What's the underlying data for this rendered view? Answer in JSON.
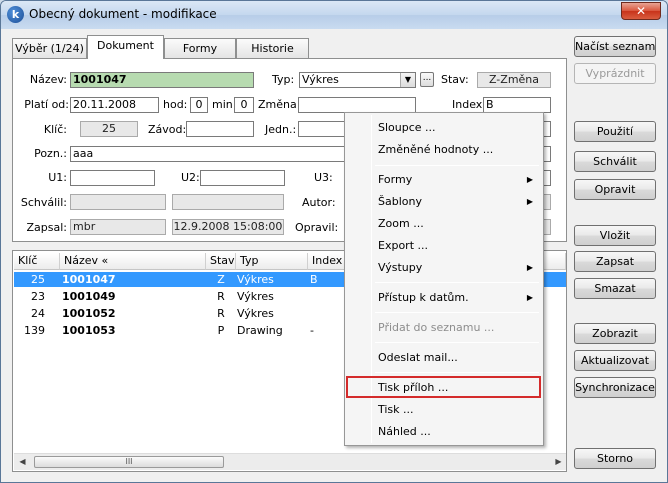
{
  "window": {
    "title": "Obecný dokument - modifikace",
    "close_label": "✕"
  },
  "tabs": [
    {
      "label": "Výběr (1/24)"
    },
    {
      "label": "Dokument"
    },
    {
      "label": "Formy"
    },
    {
      "label": "Historie"
    }
  ],
  "form": {
    "nazev_label": "Název:",
    "nazev_value": "1001047",
    "typ_label": "Typ:",
    "typ_value": "Výkres",
    "typ_more": "...",
    "stav_label": "Stav:",
    "stav_value": "Z-Změna",
    "platiod_label": "Platí od:",
    "platiod_value": "20.11.2008",
    "hod_label": "hod:",
    "hod_value": "0",
    "min_label": "min:",
    "min_value": "0",
    "zmena_label": "Změna:",
    "zmena_value": "",
    "index_label": "Index:",
    "index_value": "B",
    "klic_label": "Klíč:",
    "klic_value": "25",
    "zavod_label": "Závod:",
    "zavod_value": "",
    "jedn_label": "Jedn.:",
    "pozn_label": "Pozn.:",
    "pozn_value": "aaa",
    "u1_label": "U1:",
    "u2_label": "U2:",
    "u3_label": "U3:",
    "schvalil_label": "Schválil:",
    "autor_label": "Autor:",
    "zapsal_label": "Zapsal:",
    "zapsal_value": "mbr",
    "zapsal_date": "12.9.2008 15:08:00",
    "opravil_label": "Opravil:"
  },
  "grid": {
    "columns": [
      "Klíč",
      "Název «",
      "Stav",
      "Typ",
      "Index"
    ],
    "rows": [
      {
        "klic": "25",
        "nazev": "1001047",
        "stav": "Z",
        "typ": "Výkres",
        "index": "B"
      },
      {
        "klic": "23",
        "nazev": "1001049",
        "stav": "R",
        "typ": "Výkres",
        "index": ""
      },
      {
        "klic": "24",
        "nazev": "1001052",
        "stav": "R",
        "typ": "Výkres",
        "index": ""
      },
      {
        "klic": "139",
        "nazev": "1001053",
        "stav": "P",
        "typ": "Drawing",
        "index": "-"
      }
    ],
    "scroll_thumb": "III"
  },
  "buttons": {
    "nacist": "Načíst seznam",
    "vyprazdnit": "Vyprázdnit",
    "pouziti": "Použití",
    "schvalit": "Schválit",
    "opravit": "Opravit",
    "vlozit": "Vložit",
    "zapsat": "Zapsat",
    "smazat": "Smazat",
    "zobrazit": "Zobrazit",
    "aktualizovat": "Aktualizovat",
    "synchronizace": "Synchronizace",
    "storno": "Storno"
  },
  "menu": {
    "items": [
      "Sloupce ...",
      "Změněné hodnoty ...",
      "Formy",
      "Šablony",
      "Zoom ...",
      "Export ...",
      "Výstupy",
      "Přístup k datům.",
      "Přidat do seznamu ...",
      "Odeslat mail...",
      "Tisk příloh ...",
      "Tisk ...",
      "Náhled ..."
    ]
  },
  "colors": {
    "highlight_box": "#d42b2b",
    "selection": "#3399ff",
    "name_field": "#b7dbb0"
  }
}
